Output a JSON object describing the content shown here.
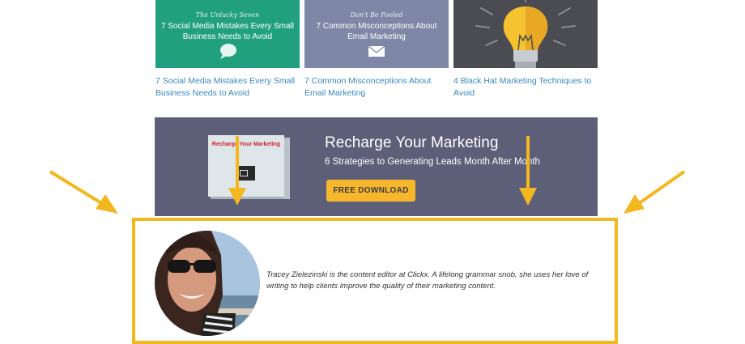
{
  "related_posts": [
    {
      "kicker": "The Unlucky Seven",
      "thumb_title": "7 Social Media Mistakes Every Small Business Needs to Avoid",
      "link": "7 Social Media Mistakes Every Small Business Needs to Avoid",
      "icon": "chat-bubble-icon",
      "color": "#21a07e"
    },
    {
      "kicker": "Don't Be Fooled",
      "thumb_title": "7 Common Misconceptions About Email Marketing",
      "link": "7 Common Misconceptions About Email Marketing",
      "icon": "envelope-icon",
      "color": "#7e88a6"
    },
    {
      "kicker": "",
      "thumb_title": "",
      "link": "4 Black Hat Marketing Techniques to Avoid",
      "icon": "lightbulb-icon",
      "color": "#4a4c52"
    }
  ],
  "banner": {
    "title": "Recharge Your Marketing",
    "subtitle": "6 Strategies to Generating Leads Month After Month",
    "button_label": "FREE DOWNLOAD",
    "ebook_title": "Recharge Your Marketing",
    "accent": "#f7b72a",
    "background": "#5d5e78"
  },
  "author": {
    "bio": "Tracey Zielezinski is the content editor at Clickx. A lifelong grammar snob, she uses her love of writing to help clients improve the quality of their marketing content."
  },
  "annotation": {
    "highlight_color": "#f3b71f"
  }
}
